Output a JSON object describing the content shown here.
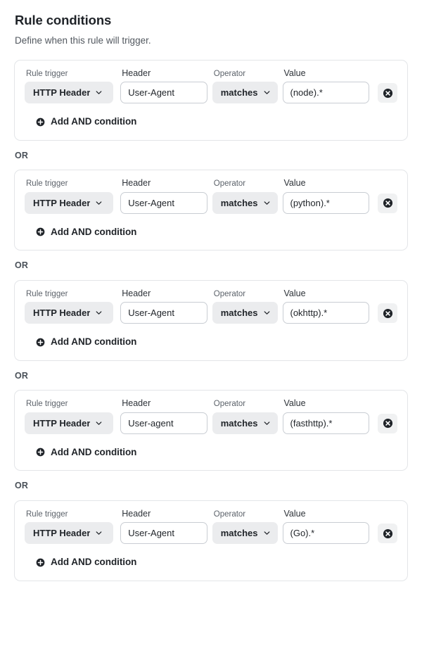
{
  "header": {
    "title": "Rule conditions",
    "subtitle": "Define when this rule will trigger."
  },
  "labels": {
    "rule_trigger": "Rule trigger",
    "header": "Header",
    "operator": "Operator",
    "value": "Value"
  },
  "or_separator": "OR",
  "add_and_label": "Add AND condition",
  "colors": {
    "card_border": "#e3e5e8",
    "select_bg": "#ebecee",
    "input_border": "#c9cdd3",
    "delete_btn_bg": "#f0f1f2",
    "icon_fill": "#1f2328",
    "text_primary": "#1f2328",
    "text_muted": "#5c626a"
  },
  "icons": {
    "chevron_down": "chevron-down-icon",
    "delete": "close-circle-icon",
    "add": "plus-circle-icon"
  },
  "conditions": [
    {
      "trigger": "HTTP Header",
      "header": "User-Agent",
      "operator": "matches",
      "value": "(node).*"
    },
    {
      "trigger": "HTTP Header",
      "header": "User-Agent",
      "operator": "matches",
      "value": "(python).*"
    },
    {
      "trigger": "HTTP Header",
      "header": "User-Agent",
      "operator": "matches",
      "value": "(okhttp).*"
    },
    {
      "trigger": "HTTP Header",
      "header": "User-agent",
      "operator": "matches",
      "value": "(fasthttp).*"
    },
    {
      "trigger": "HTTP Header",
      "header": "User-Agent",
      "operator": "matches",
      "value": "(Go).*"
    }
  ]
}
